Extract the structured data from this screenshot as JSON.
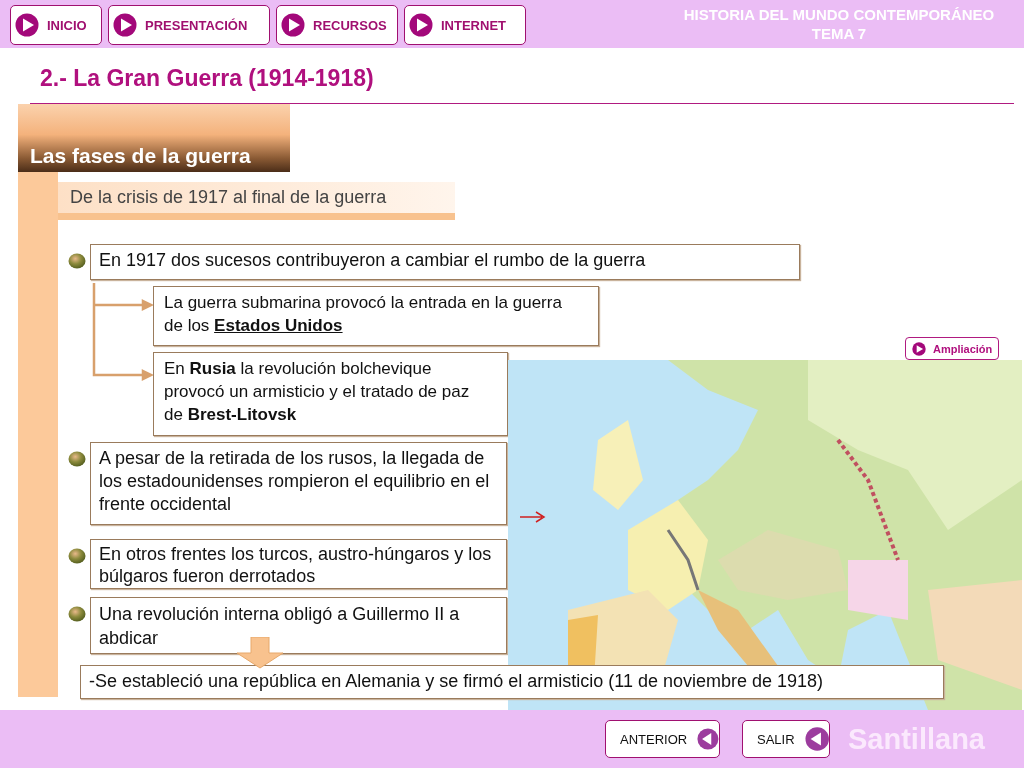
{
  "nav": [
    {
      "label": "INICIO"
    },
    {
      "label": "PRESENTACIÓN"
    },
    {
      "label": "RECURSOS"
    },
    {
      "label": "INTERNET"
    }
  ],
  "header": {
    "subject": "HISTORIA DEL MUNDO CONTEMPORÁNEO",
    "unit": "TEMA 7"
  },
  "title": "2.- La Gran Guerra (1914-1918)",
  "section": "Las fases de la guerra",
  "subsection": "De la crisis de 1917 al final de la guerra",
  "points": [
    {
      "text": "En 1917 dos sucesos contribuyeron a cambiar el rumbo de la guerra",
      "children": [
        {
          "text": "La guerra submarina provocó la entrada en la guerra de los **Estados Unidos**",
          "underlined": true
        },
        {
          "text": "En **Rusia** la revolución bolchevique provocó un armisticio y el tratado de paz de **Brest-Litovsk**",
          "underlined": false
        }
      ]
    },
    {
      "text": "A pesar de la retirada de los rusos, la llegada de los estadounidenses rompieron el equilibrio en el frente occidental"
    },
    {
      "text": "En otros frentes los turcos, austro-húngaros y los búlgaros fueron derrotados"
    },
    {
      "text": "Una revolución interna obligó a Guillermo II a abdicar"
    }
  ],
  "conclusion": "-Se estableció una república en Alemania y se firmó el armisticio (11 de noviembre de 1918)",
  "more_button": "Ampliación",
  "footer": {
    "buttons": [
      "ANTERIOR",
      "SALIR"
    ],
    "brand": "Santillana"
  }
}
